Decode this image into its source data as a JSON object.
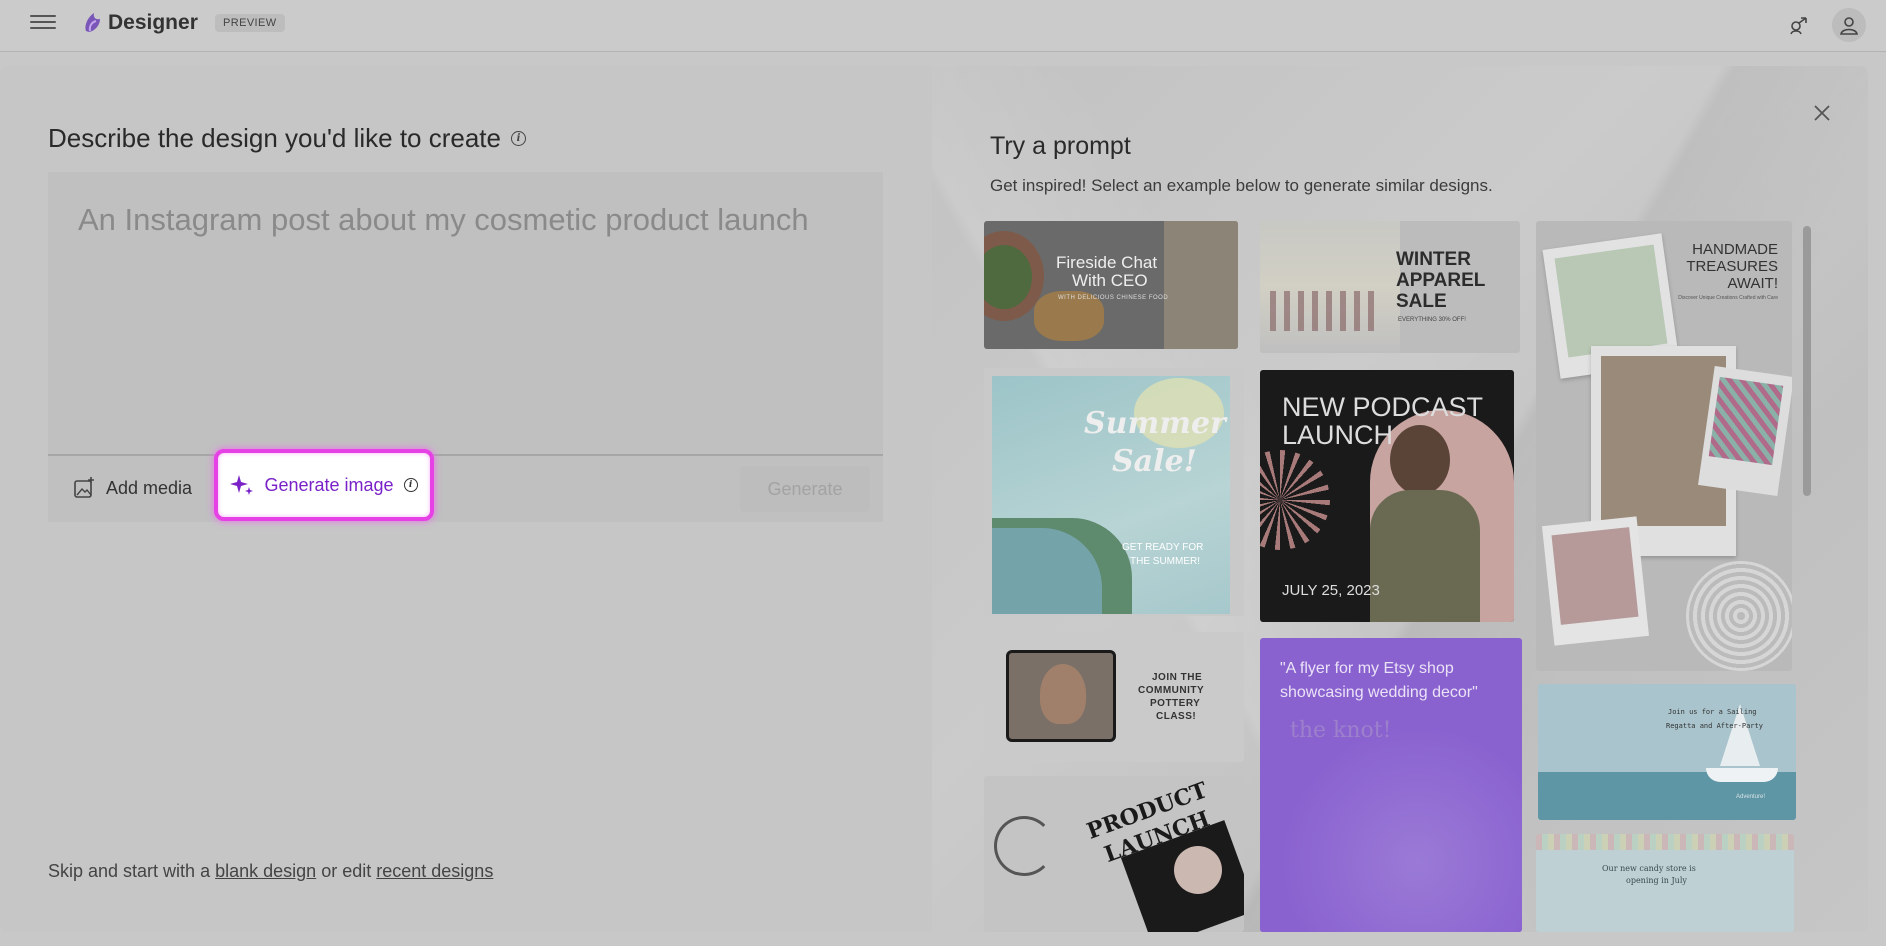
{
  "header": {
    "brand": "Designer",
    "badge": "PREVIEW"
  },
  "left": {
    "heading": "Describe the design you'd like to create",
    "prompt_placeholder": "An Instagram post about my cosmetic product launch",
    "add_media_label": "Add media",
    "generate_image_label": "Generate image",
    "generate_label": "Generate",
    "footer": {
      "prefix": "Skip and start with a",
      "blank_link": "blank design",
      "middle": "or edit",
      "recent_link": "recent designs"
    }
  },
  "right": {
    "heading": "Try a prompt",
    "subheading": "Get inspired! Select an example below to generate similar designs.",
    "cards": [
      {
        "lines": [
          "Fireside Chat",
          "With CEO"
        ],
        "small": "WITH DELICIOUS CHINESE FOOD"
      },
      {
        "lines": [
          "WINTER",
          "APPAREL",
          "SALE"
        ],
        "small": "EVERYTHING 30% OFF!"
      },
      {
        "lines": [
          "HANDMADE",
          "TREASURES",
          "AWAIT!"
        ],
        "small": "Discover Unique Creations Crafted with Care"
      },
      {
        "lines": [
          "Summer",
          "Sale!"
        ],
        "small_lines": [
          "GET READY FOR",
          "THE SUMMER!"
        ]
      },
      {
        "lines": [
          "NEW PODCAST",
          "LAUNCH"
        ],
        "date": "JULY 25, 2023"
      },
      {
        "lines": [
          "JOIN THE",
          "COMMUNITY",
          "POTTERY",
          "CLASS!"
        ]
      },
      {
        "lines": [
          "\"A flyer for my Etsy shop",
          "showcasing wedding decor\""
        ],
        "faded": "the knot!"
      },
      {
        "lines": [
          "Join us for a Sailing",
          "Regatta and After-Party"
        ],
        "small": "Adventure!"
      },
      {
        "lines": [
          "PRODUCT",
          "LAUNCH"
        ]
      },
      {
        "lines": [
          "Our new candy store is",
          "opening in July"
        ]
      }
    ]
  }
}
